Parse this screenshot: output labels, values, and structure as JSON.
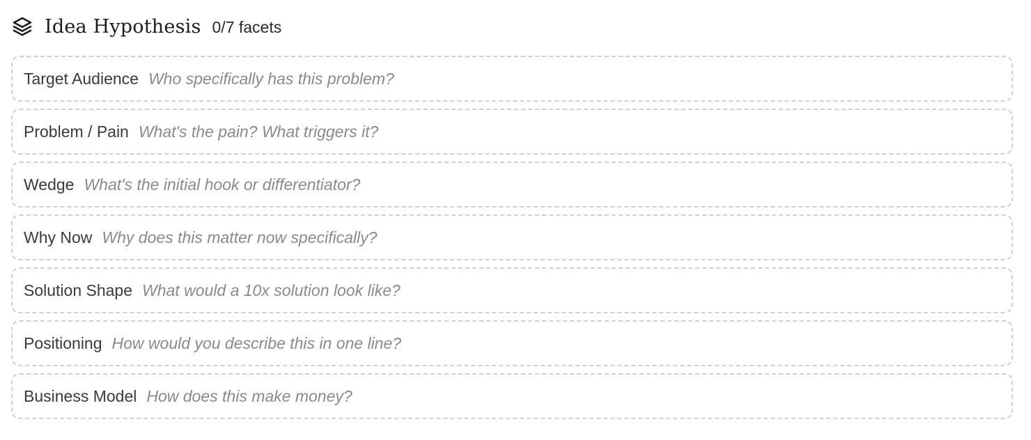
{
  "header": {
    "icon": "layers-icon",
    "title": "Idea Hypothesis",
    "count": "0/7 facets"
  },
  "facets": [
    {
      "label": "Target Audience",
      "prompt": "Who specifically has this problem?"
    },
    {
      "label": "Problem / Pain",
      "prompt": "What's the pain? What triggers it?"
    },
    {
      "label": "Wedge",
      "prompt": "What's the initial hook or differentiator?"
    },
    {
      "label": "Why Now",
      "prompt": "Why does this matter now specifically?"
    },
    {
      "label": "Solution Shape",
      "prompt": "What would a 10x solution look like?"
    },
    {
      "label": "Positioning",
      "prompt": "How would you describe this in one line?"
    },
    {
      "label": "Business Model",
      "prompt": "How does this make money?"
    }
  ],
  "colors": {
    "border": "#cfcfcf",
    "label": "#3a3a3a",
    "prompt": "#8a8a8a",
    "title": "#1c1c1c"
  }
}
